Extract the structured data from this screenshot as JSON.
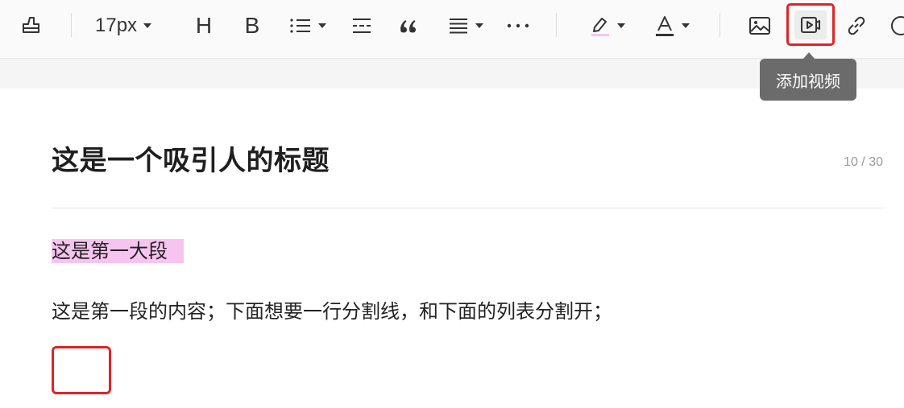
{
  "toolbar": {
    "font_size": "17px",
    "heading_glyph": "H",
    "bold_glyph": "B",
    "icons": [
      "format-painter-icon",
      "heading-icon",
      "bold-icon",
      "list-icon",
      "divider-icon",
      "quote-icon",
      "align-icon",
      "more-icon",
      "highlight-icon",
      "font-color-icon",
      "image-icon",
      "video-icon",
      "link-icon",
      "emoji-icon"
    ],
    "highlight_color": "#f7c4f2"
  },
  "tooltip": {
    "text": "添加视频"
  },
  "editor": {
    "title": "这是一个吸引人的标题",
    "title_counter": "10 / 30",
    "paragraph_heading": "这是第一大段",
    "paragraph_text": "这是第一段的内容；下面想要一行分割线，和下面的列表分割开；"
  },
  "colors": {
    "accent_red": "#e02424",
    "highlight_pink": "#f7c4f2",
    "tooltip_bg": "#6b6b6b"
  }
}
